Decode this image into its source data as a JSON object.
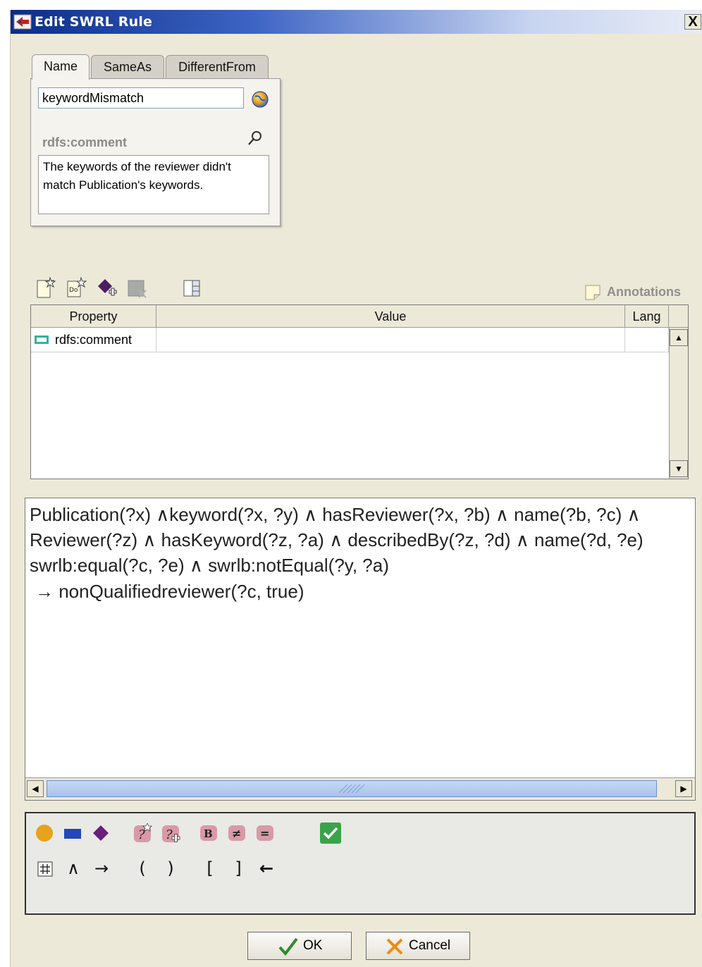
{
  "window": {
    "title": "Edit SWRL Rule",
    "close_label": "X"
  },
  "tabs": [
    {
      "label": "Name",
      "active": true
    },
    {
      "label": "SameAs",
      "active": false
    },
    {
      "label": "DifferentFrom",
      "active": false
    }
  ],
  "name_panel": {
    "name_value": "keywordMismatch",
    "comment_label": "rdfs:comment",
    "comment_text": "The keywords of the reviewer didn't match Publication's keywords."
  },
  "annotations": {
    "label": "Annotations",
    "columns": [
      "Property",
      "Value",
      "Lang"
    ],
    "rows": [
      {
        "property": "rdfs:comment",
        "value": "",
        "lang": ""
      }
    ]
  },
  "rule": {
    "lines": [
      "Publication(?x)  ∧keyword(?x, ?y)  ∧ hasReviewer(?x, ?b)  ∧ name(?b, ?c)  ∧",
      "Reviewer(?z)  ∧ hasKeyword(?z, ?a)  ∧ describedBy(?z, ?d)  ∧ name(?d, ?e)",
      "swrlb:equal(?c, ?e)  ∧ swrlb:notEqual(?y, ?a)",
      " →  nonQualifiedreviewer(?c, true)"
    ]
  },
  "palette": {
    "row1": [
      "class-circle-icon",
      "property-rect-icon",
      "individual-diamond-icon",
      "variable-icon",
      "new-variable-icon",
      "builtin-icon",
      "different-icon",
      "same-icon",
      "check-icon"
    ],
    "row2_symbols": [
      "#",
      "∧",
      "→",
      "(",
      ")",
      "[",
      "]",
      "←"
    ],
    "builtin_labels": [
      "B",
      "≠",
      "="
    ]
  },
  "buttons": {
    "ok": "OK",
    "cancel": "Cancel"
  },
  "colors": {
    "title_start": "#0b2d88",
    "dialog_bg": "#ece9d8",
    "class_color": "#e8a21c",
    "property_color": "#2147b8",
    "individual_color": "#6a1f7a",
    "check_color": "#3aa34a"
  }
}
